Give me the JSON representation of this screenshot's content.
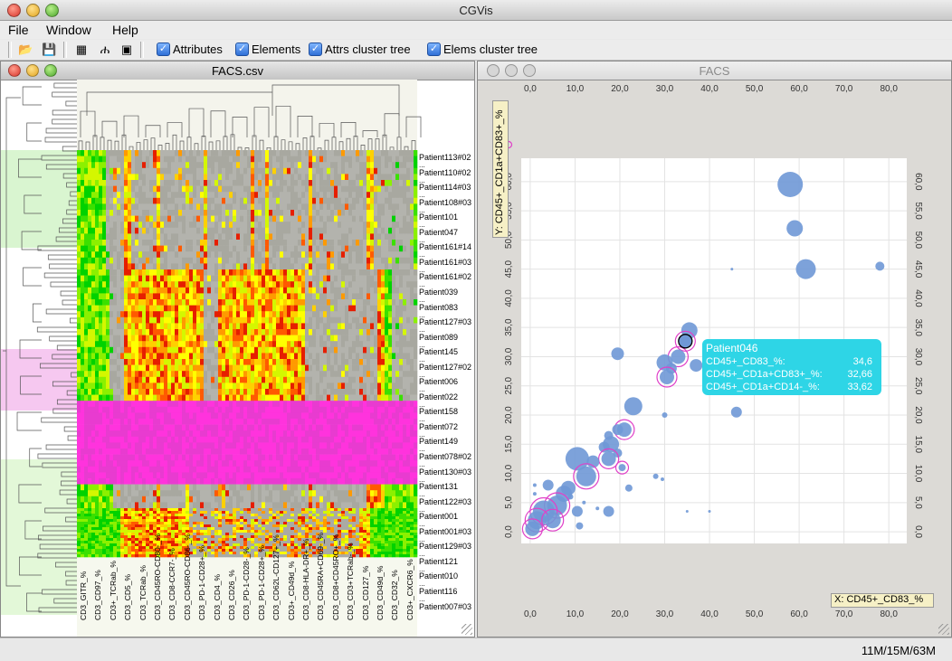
{
  "app": {
    "title": "CGVis"
  },
  "menu": [
    "File",
    "Window",
    "Help"
  ],
  "toolbar": {
    "icons": [
      "open-icon",
      "save-icon",
      "grid-icon",
      "tree-icon",
      "palette-icon"
    ],
    "checkboxes": [
      {
        "label": "Attributes",
        "checked": true
      },
      {
        "label": "Elements",
        "checked": true
      },
      {
        "label": "Attrs cluster tree",
        "checked": true
      },
      {
        "label": "Elems cluster tree",
        "checked": true
      }
    ]
  },
  "left_window": {
    "title": "FACS.csv",
    "patients": [
      "Patient113#02",
      "Patient110#02",
      "Patient114#03",
      "Patient108#03",
      "Patient101",
      "Patient047",
      "Patient161#14",
      "Patient161#03",
      "Patient161#02",
      "Patient039",
      "Patient083",
      "Patient127#03",
      "Patient089",
      "Patient145",
      "Patient127#02",
      "Patient006",
      "Patient022",
      "Patient158",
      "Patient072",
      "Patient149",
      "Patient078#02",
      "Patient130#03",
      "Patient131",
      "Patient122#03",
      "Patient001",
      "Patient001#03",
      "Patient129#03",
      "Patient121",
      "Patient010",
      "Patient116",
      "Patient007#03"
    ],
    "ellipsis": "...",
    "columns": [
      "CD3_GITR_%",
      "CD3_CD97_%",
      "CD3+_TCRab_%",
      "CD3_CD5_%",
      "CD3_TCRab_%",
      "CD3_CD45RO-CD80-_%",
      "CD3_CD8-CCR7-_%",
      "CD3_CD45RO-CD86-_%",
      "CD3_PD-1-CD28+_%",
      "CD3_CD4_%",
      "CD3_CD26_%",
      "CD3_PD-1-CD28-_%",
      "CD3_PD-1-CD28+_%",
      "CD3_CD62L-CD127+_%",
      "CD3+_CD49d_%",
      "CD3_CD8-HLA-DR+_%",
      "CD3_CD45RA+CD69-_%",
      "CD3_CD8+CD45RO+_%",
      "CD3_CD3+TCRab-_%",
      "CD3_CD127_%",
      "CD3_CD49d_%",
      "CD3_CD32_%",
      "CD3+_CXCR6_%"
    ]
  },
  "right_window": {
    "title": "FACS",
    "y_label": "Y: CD45+_CD1a+CD83+_%",
    "x_label": "X: CD45+_CD83_%",
    "tooltip": {
      "title": "Patient046",
      "rows": [
        {
          "label": "CD45+_CD83_%:",
          "value": "34,6"
        },
        {
          "label": "CD45+_CD1a+CD83+_%:",
          "value": "32,66"
        },
        {
          "label": "CD45+_CD1a+CD14-_%:",
          "value": "33,62"
        }
      ]
    }
  },
  "chart_data": {
    "type": "scatter",
    "xlabel": "X: CD45+_CD83_%",
    "ylabel": "Y: CD45+_CD1a+CD83+_%",
    "xticks": [
      "0,0",
      "10,0",
      "20,0",
      "30,0",
      "40,0",
      "50,0",
      "60,0",
      "70,0",
      "80,0"
    ],
    "yticks": [
      "0,0",
      "5,0",
      "10,0",
      "15,0",
      "20,0",
      "25,0",
      "30,0",
      "35,0",
      "40,0",
      "45,0",
      "50,0",
      "55,0",
      "60,0"
    ],
    "xlim": [
      -2,
      84
    ],
    "ylim": [
      -2,
      64
    ],
    "points": [
      {
        "x": 58,
        "y": 59.5,
        "s": 14,
        "h": false
      },
      {
        "x": 59,
        "y": 52,
        "s": 9,
        "h": false
      },
      {
        "x": 61.5,
        "y": 45,
        "s": 11,
        "h": false
      },
      {
        "x": 78,
        "y": 45.5,
        "s": 5,
        "h": false
      },
      {
        "x": 45,
        "y": 45,
        "s": 1.5,
        "h": false
      },
      {
        "x": 35.5,
        "y": 34.5,
        "s": 9,
        "h": false
      },
      {
        "x": 34.6,
        "y": 32.66,
        "s": 8,
        "h": true
      },
      {
        "x": 33,
        "y": 30,
        "s": 8,
        "h": true
      },
      {
        "x": 30,
        "y": 29,
        "s": 9,
        "h": false
      },
      {
        "x": 31.5,
        "y": 28,
        "s": 6,
        "h": false
      },
      {
        "x": 30.5,
        "y": 26.5,
        "s": 8,
        "h": true
      },
      {
        "x": 37,
        "y": 28.5,
        "s": 7,
        "h": false
      },
      {
        "x": 19.5,
        "y": 30.5,
        "s": 7,
        "h": false
      },
      {
        "x": 23,
        "y": 21.5,
        "s": 10,
        "h": false
      },
      {
        "x": 46,
        "y": 20.5,
        "s": 6,
        "h": false
      },
      {
        "x": 30,
        "y": 20,
        "s": 3,
        "h": false
      },
      {
        "x": 21,
        "y": 17.5,
        "s": 8,
        "h": true
      },
      {
        "x": 19.5,
        "y": 17.5,
        "s": 6,
        "h": false
      },
      {
        "x": 17.5,
        "y": 16.5,
        "s": 5,
        "h": false
      },
      {
        "x": 18,
        "y": 15,
        "s": 9,
        "h": false
      },
      {
        "x": 16.5,
        "y": 14.5,
        "s": 6,
        "h": false
      },
      {
        "x": 19.5,
        "y": 13.5,
        "s": 5,
        "h": false
      },
      {
        "x": 10.5,
        "y": 12.5,
        "s": 13,
        "h": false
      },
      {
        "x": 17.5,
        "y": 12.5,
        "s": 8,
        "h": true
      },
      {
        "x": 14,
        "y": 12,
        "s": 7,
        "h": false
      },
      {
        "x": 20.5,
        "y": 11,
        "s": 4,
        "h": true
      },
      {
        "x": 12.5,
        "y": 9.5,
        "s": 11,
        "h": true
      },
      {
        "x": 8.5,
        "y": 7.5,
        "s": 8,
        "h": false
      },
      {
        "x": 7.5,
        "y": 6.5,
        "s": 9,
        "h": false
      },
      {
        "x": 4,
        "y": 8,
        "s": 6,
        "h": false
      },
      {
        "x": 22,
        "y": 7.5,
        "s": 4,
        "h": false
      },
      {
        "x": 28,
        "y": 9.5,
        "s": 3,
        "h": false
      },
      {
        "x": 29.5,
        "y": 9,
        "s": 2,
        "h": false
      },
      {
        "x": 6,
        "y": 4.5,
        "s": 11,
        "h": true
      },
      {
        "x": 3,
        "y": 3.5,
        "s": 12,
        "h": true
      },
      {
        "x": 1.5,
        "y": 2,
        "s": 10,
        "h": true
      },
      {
        "x": 5,
        "y": 2,
        "s": 9,
        "h": true
      },
      {
        "x": 10.5,
        "y": 3.5,
        "s": 6,
        "h": false
      },
      {
        "x": 17.5,
        "y": 3.5,
        "s": 6,
        "h": false
      },
      {
        "x": 11,
        "y": 1,
        "s": 4,
        "h": false
      },
      {
        "x": 0.5,
        "y": 0.5,
        "s": 8,
        "h": true
      },
      {
        "x": 1,
        "y": 6.5,
        "s": 2,
        "h": false
      },
      {
        "x": 1,
        "y": 8,
        "s": 2,
        "h": false
      },
      {
        "x": 12,
        "y": 5,
        "s": 2,
        "h": false
      },
      {
        "x": 15,
        "y": 4,
        "s": 2,
        "h": false
      },
      {
        "x": 35,
        "y": 3.5,
        "s": 1.5,
        "h": false
      },
      {
        "x": 40,
        "y": 3.5,
        "s": 1.5,
        "h": false
      },
      {
        "x": 9,
        "y": 6,
        "s": 3,
        "h": false
      }
    ],
    "grid": true,
    "legend": "none"
  },
  "status": {
    "memory": "11M/15M/63M"
  }
}
